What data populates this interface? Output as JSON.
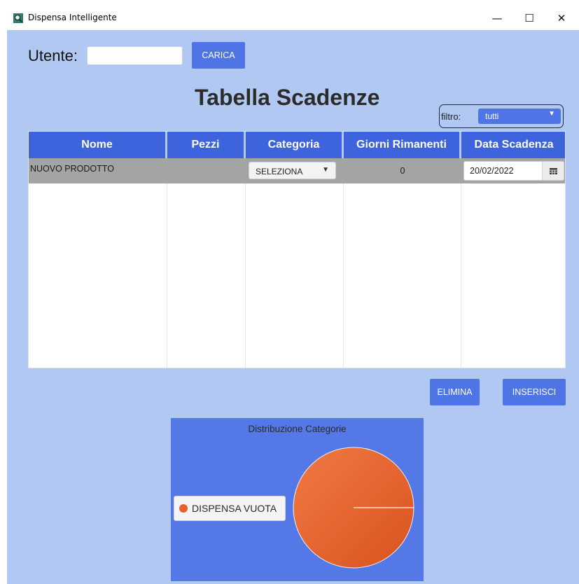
{
  "window": {
    "title": "Dispensa Intelligente",
    "controls": {
      "minimize": "—",
      "maximize": "☐",
      "close": "✕"
    }
  },
  "user": {
    "label": "Utente:",
    "value": "",
    "load_button": "CARICA"
  },
  "page_title": "Tabella Scadenze",
  "filter": {
    "label": "filtro:",
    "value": "tutti",
    "arrow": "▼"
  },
  "table": {
    "columns": [
      "Nome",
      "Pezzi",
      "Categoria",
      "Giorni Rimanenti",
      "Data Scadenza"
    ],
    "rows": [
      {
        "nome": "NUOVO PRODOTTO",
        "pezzi": "",
        "categoria": "SELEZIONA",
        "giorni": "0",
        "data": "20/02/2022"
      }
    ],
    "select_arrow": "▼",
    "calendar_icon": "calendar-icon"
  },
  "buttons": {
    "delete": "ELIMINA",
    "insert": "INSERISCI"
  },
  "chart_data": {
    "type": "pie",
    "title": "Distribuzione Categorie",
    "labels": [
      "DISPENSA VUOTA"
    ],
    "values": [
      100
    ],
    "legend_position": "left",
    "colors": [
      "#e8602a"
    ]
  },
  "colors": {
    "accent": "#4f74e6",
    "header": "#3d63dd",
    "background": "#b0c8f2",
    "row": "#a4a4a4",
    "pie": "#e8602a"
  }
}
